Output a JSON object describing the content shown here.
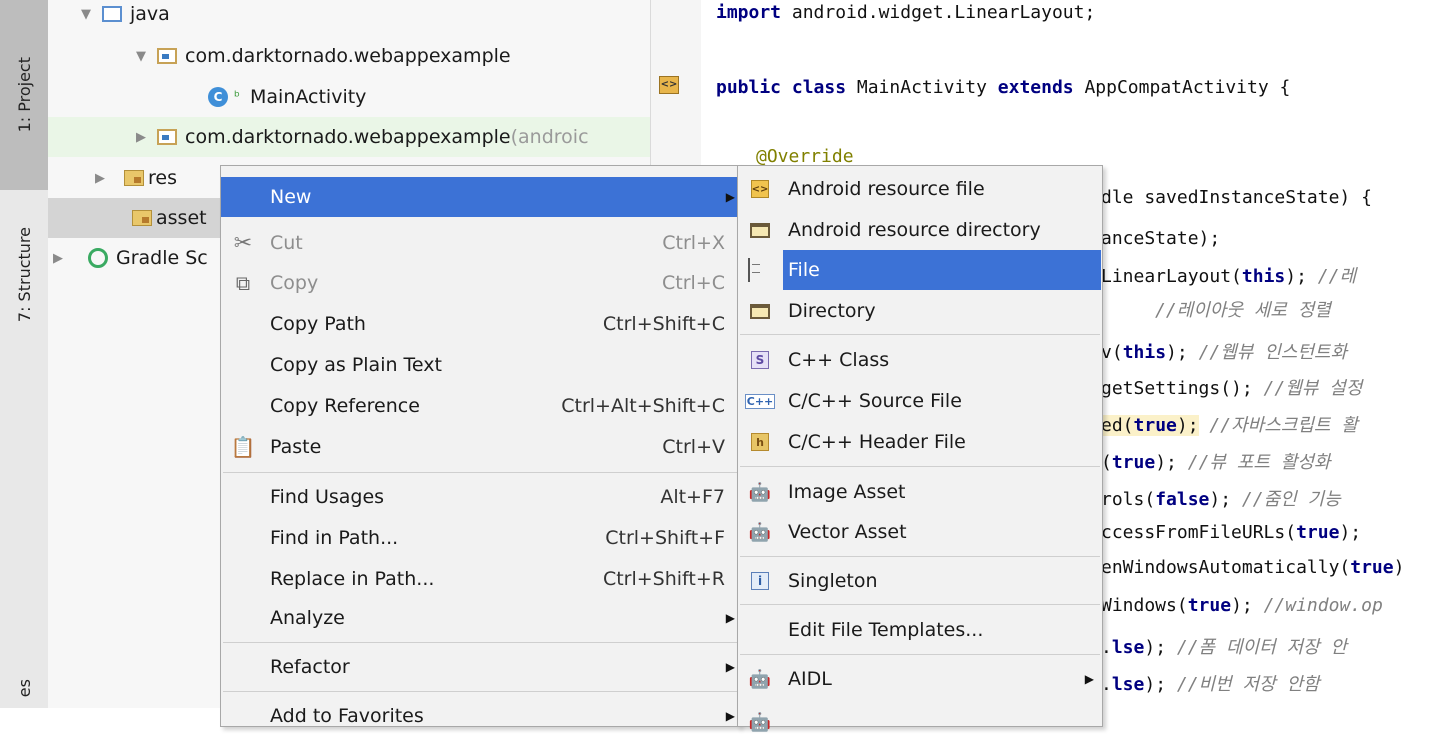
{
  "tool_strip": {
    "project_tab": "1: Project",
    "structure_tab": "7: Structure",
    "bottom_tab": "es"
  },
  "tree": {
    "rows": [
      {
        "label": "java",
        "suffix": ""
      },
      {
        "label": "com.darktornado.webappexample",
        "suffix": ""
      },
      {
        "label": "MainActivity",
        "suffix": ""
      },
      {
        "label": "com.darktornado.webappexample",
        "suffix": " (androic"
      },
      {
        "label": "res",
        "suffix": ""
      },
      {
        "label": "asset",
        "suffix": ""
      },
      {
        "label": "Gradle Sc",
        "suffix": ""
      }
    ]
  },
  "editor": {
    "lines": [
      {
        "a": "import",
        "b": " android.widget.LinearLayout;"
      },
      {
        "kw1": "public class",
        "mid": " MainActivity ",
        "kw2": "extends",
        "end": " AppCompatActivity {"
      },
      {
        "ann": "@Override"
      },
      {
        "text": "dle savedInstanceState) {"
      },
      {
        "text": "anceState);"
      },
      {
        "pre": " LinearLayout(",
        "kw": "this",
        "post": ");",
        "cm": "   //레"
      },
      {
        "cm": "//레이아웃 세로 정렬"
      },
      {
        "pre": "v(",
        "kw": "this",
        "post": ");",
        "cm": "  //웹뷰 인스턴트화"
      },
      {
        "pre": "getSettings();",
        "cm": "  //웹뷰 설정"
      },
      {
        "pre": "ed(",
        "kw": "true",
        "post": ");",
        "cm": "  //자바스크립트 활"
      },
      {
        "pre": "(",
        "kw": "true",
        "post": ");",
        "cm": "  //뷰 포트 활성화"
      },
      {
        "pre": "rols(",
        "kw": "false",
        "post": ");",
        "cm": "  //줌인 기능"
      },
      {
        "pre": "ccessFromFileURLs(",
        "kw": "true",
        "post": ");"
      },
      {
        "pre": "enWindowsAutomatically(",
        "kw": "true",
        "post": ")"
      },
      {
        "pre": "Windows(",
        "kw": "true",
        "post": ");",
        "cm": "  //window.op"
      },
      {
        "pre": ".",
        "kw": "lse",
        "post": ");",
        "cm": "  //폼 데이터 저장 안"
      },
      {
        "pre": ".",
        "kw": "lse",
        "post": ");",
        "cm": "  //비번 저장 안함"
      }
    ]
  },
  "context_menu": {
    "items": [
      {
        "label": "New",
        "shortcut": ""
      },
      {
        "label": "Cut",
        "shortcut": "Ctrl+X"
      },
      {
        "label": "Copy",
        "shortcut": "Ctrl+C"
      },
      {
        "label": "Copy Path",
        "shortcut": "Ctrl+Shift+C"
      },
      {
        "label": "Copy as Plain Text",
        "shortcut": ""
      },
      {
        "label": "Copy Reference",
        "shortcut": "Ctrl+Alt+Shift+C"
      },
      {
        "label": "Paste",
        "shortcut": "Ctrl+V"
      },
      {
        "label": "Find Usages",
        "shortcut": "Alt+F7"
      },
      {
        "label": "Find in Path...",
        "shortcut": "Ctrl+Shift+F"
      },
      {
        "label": "Replace in Path...",
        "shortcut": "Ctrl+Shift+R"
      },
      {
        "label": "Analyze",
        "shortcut": ""
      },
      {
        "label": "Refactor",
        "shortcut": ""
      },
      {
        "label": "Add to Favorites",
        "shortcut": ""
      }
    ]
  },
  "new_submenu": {
    "items": [
      {
        "label": "Android resource file"
      },
      {
        "label": "Android resource directory"
      },
      {
        "label": "File"
      },
      {
        "label": "Directory"
      },
      {
        "label": "C++ Class"
      },
      {
        "label": "C/C++ Source File"
      },
      {
        "label": "C/C++ Header File"
      },
      {
        "label": "Image Asset"
      },
      {
        "label": "Vector Asset"
      },
      {
        "label": "Singleton"
      },
      {
        "label": "Edit File Templates..."
      },
      {
        "label": "AIDL"
      }
    ]
  },
  "colors": {
    "menu_highlight": "#3c72d6",
    "keyword": "#000080",
    "comment": "#808080",
    "android_green": "#80b638"
  }
}
